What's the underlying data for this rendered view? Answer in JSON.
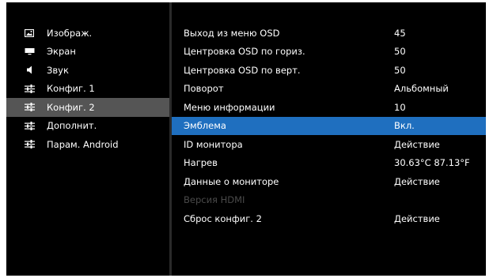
{
  "left_menu": {
    "items": [
      {
        "label": "Изображ.",
        "icon": "picture-icon"
      },
      {
        "label": "Экран",
        "icon": "screen-icon"
      },
      {
        "label": "Звук",
        "icon": "speaker-icon"
      },
      {
        "label": "Конфиг. 1",
        "icon": "sliders-icon"
      },
      {
        "label": "Конфиг. 2",
        "icon": "sliders-icon",
        "selected": true
      },
      {
        "label": "Дополнит.",
        "icon": "sliders-icon"
      },
      {
        "label": "Парам. Android",
        "icon": "sliders-icon"
      }
    ]
  },
  "settings": {
    "rows": [
      {
        "name": "Выход из меню OSD",
        "value": "45"
      },
      {
        "name": "Центровка OSD по гориз.",
        "value": "50"
      },
      {
        "name": "Центровка OSD по верт.",
        "value": "50"
      },
      {
        "name": "Поворот",
        "value": "Альбомный"
      },
      {
        "name": "Меню информации",
        "value": "10"
      },
      {
        "name": "Эмблема",
        "value": "Вкл.",
        "highlighted": true
      },
      {
        "name": "ID монитора",
        "value": "Действие"
      },
      {
        "name": "Нагрев",
        "value": "30.63°C 87.13°F"
      },
      {
        "name": "Данные о мониторе",
        "value": "Действие"
      },
      {
        "name": "Версия HDMI",
        "value": "",
        "disabled": true
      },
      {
        "name": "Сброс конфиг. 2",
        "value": "Действие"
      }
    ]
  },
  "colors": {
    "background": "#000000",
    "selected_menu": "#555555",
    "highlight_row": "#1f6fbf",
    "text": "#ffffff",
    "disabled_text": "#4a4a4a"
  }
}
